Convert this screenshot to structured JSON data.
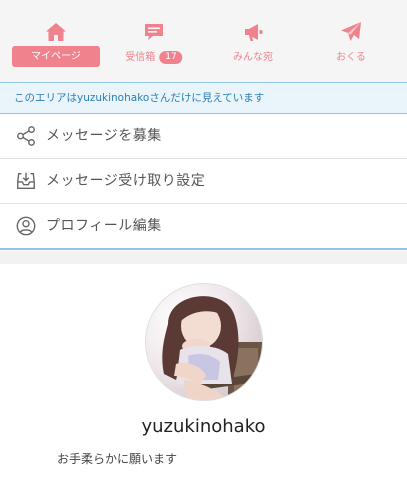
{
  "tabs": [
    {
      "label": "マイページ",
      "icon": "home-icon",
      "active": true
    },
    {
      "label": "受信箱",
      "icon": "chat-icon",
      "badge": "17"
    },
    {
      "label": "みんな宛",
      "icon": "megaphone-icon"
    },
    {
      "label": "おくる",
      "icon": "send-icon"
    }
  ],
  "notice": "このエリアはyuzukinohakoさんだけに見えています",
  "menu": [
    {
      "label": "メッセージを募集",
      "icon": "share-icon"
    },
    {
      "label": "メッセージ受け取り設定",
      "icon": "inbox-download-icon"
    },
    {
      "label": "プロフィール編集",
      "icon": "user-circle-icon"
    }
  ],
  "profile": {
    "username": "yuzukinohako",
    "bio": "お手柔らかに願います"
  },
  "colors": {
    "accent": "#f0828d",
    "info": "#2b7fb3",
    "info_bg": "#eaf5fb",
    "divider": "#8fc6e4"
  }
}
